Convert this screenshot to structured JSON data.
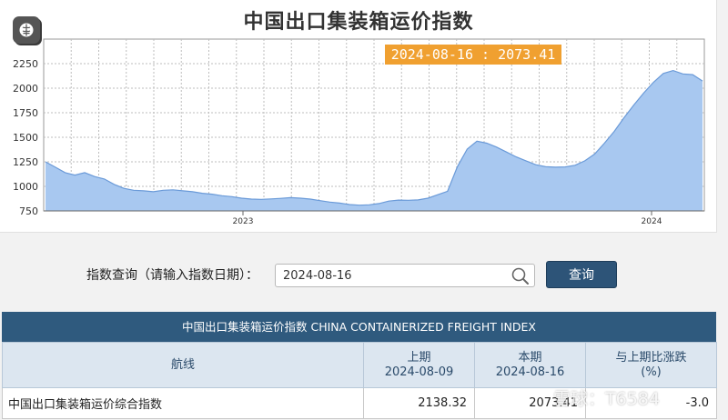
{
  "chart": {
    "title": "中国出口集装箱运价指数",
    "tooltip": "2024-08-16 : 2073.41"
  },
  "chart_data": {
    "type": "area",
    "title": "中国出口集装箱运价指数",
    "ylim": [
      750,
      2500
    ],
    "yticks": [
      750,
      1000,
      1250,
      1500,
      1750,
      2000,
      2250
    ],
    "x_year_labels": [
      "2023",
      "2024"
    ],
    "grid": true,
    "fill_color": "#a8c8f0",
    "line_color": "#6a9ad8",
    "values": [
      1250,
      1195,
      1140,
      1115,
      1140,
      1100,
      1075,
      1020,
      980,
      960,
      955,
      945,
      960,
      965,
      955,
      945,
      930,
      920,
      905,
      895,
      880,
      870,
      868,
      872,
      878,
      885,
      880,
      870,
      855,
      840,
      830,
      815,
      808,
      812,
      825,
      850,
      860,
      858,
      862,
      880,
      915,
      950,
      1200,
      1380,
      1460,
      1440,
      1400,
      1350,
      1300,
      1260,
      1220,
      1200,
      1195,
      1198,
      1215,
      1260,
      1330,
      1440,
      1560,
      1700,
      1830,
      1950,
      2060,
      2150,
      2180,
      2145,
      2138,
      2073
    ]
  },
  "logo": {
    "icon": "brain-icon"
  },
  "search": {
    "label": "指数查询（请输入指数日期）：",
    "value": "2024-08-16",
    "button": "查询"
  },
  "table": {
    "caption": "中国出口集装箱运价指数 CHINA CONTAINERIZED FREIGHT INDEX",
    "col_route": "航线",
    "col_prev_label": "上期",
    "col_prev_date": "2024-08-09",
    "col_curr_label": "本期",
    "col_curr_date": "2024-08-16",
    "col_change_label": "与上期比涨跌",
    "col_change_unit": "(%)",
    "rows": [
      {
        "route": "中国出口集装箱运价综合指数",
        "prev": "2138.32",
        "curr": "2073.41",
        "change": "-3.0"
      }
    ]
  },
  "watermark": "雪球：T6584"
}
